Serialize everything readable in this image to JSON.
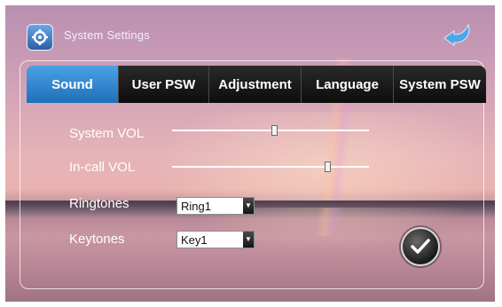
{
  "window": {
    "title": "System Settings"
  },
  "icons": {
    "app": "settings-gear-icon",
    "back": "back-arrow-icon",
    "confirm": "checkmark-icon",
    "dropdown": "dropdown-arrow-icon"
  },
  "tabs": [
    {
      "label": "Sound",
      "active": true
    },
    {
      "label": "User PSW",
      "active": false
    },
    {
      "label": "Adjustment",
      "active": false
    },
    {
      "label": "Language",
      "active": false
    },
    {
      "label": "System PSW",
      "active": false
    }
  ],
  "sound": {
    "system_vol": {
      "label": "System VOL",
      "level_fraction": 0.52
    },
    "incall_vol": {
      "label": "In-call VOL",
      "level_fraction": 0.79
    },
    "ringtones": {
      "label": "Ringtones",
      "selected": "Ring1"
    },
    "keytones": {
      "label": "Keytones",
      "selected": "Key1"
    }
  },
  "colors": {
    "tab_active": "#2b86d4",
    "tab_bar": "#111111",
    "title_text": "#f3f0ff"
  }
}
